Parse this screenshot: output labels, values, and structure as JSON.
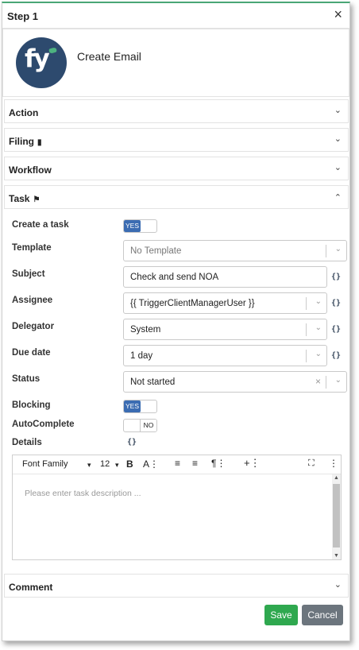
{
  "dialog": {
    "title": "Step 1",
    "close_icon": "×"
  },
  "header": {
    "name": "Create Email",
    "logo_text": "fy"
  },
  "sections": {
    "action": "Action",
    "filing": "Filing",
    "workflow": "Workflow",
    "task": "Task",
    "comment": "Comment"
  },
  "task": {
    "create_label": "Create a task",
    "create_value": "YES",
    "template_label": "Template",
    "template_value": "No Template",
    "subject_label": "Subject",
    "subject_value": "Check and send NOA",
    "assignee_label": "Assignee",
    "assignee_value": "{{ TriggerClientManagerUser }}",
    "delegator_label": "Delegator",
    "delegator_value": "System",
    "due_label": "Due date",
    "due_value": "1 day",
    "status_label": "Status",
    "status_value": "Not started",
    "blocking_label": "Blocking",
    "blocking_value": "YES",
    "autocomplete_label": "AutoComplete",
    "autocomplete_value": "NO",
    "details_label": "Details",
    "braces": "{}"
  },
  "editor": {
    "font_family": "Font Family",
    "font_size": "12",
    "bold": "B",
    "placeholder": "Please enter task description ..."
  },
  "buttons": {
    "save": "Save",
    "cancel": "Cancel"
  },
  "colors": {
    "accent_top": "#4aa776",
    "toggle_on": "#3b6cb2",
    "save": "#2fa84f",
    "cancel": "#6c757d",
    "logo_bg": "#2d4a6e"
  }
}
